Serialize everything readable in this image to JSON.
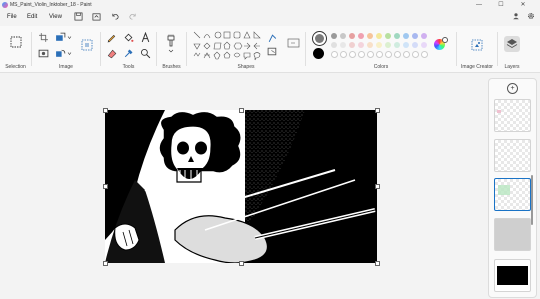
{
  "titlebar": {
    "title": "MS_Paint_Violin_Inktober_18 - Paint",
    "minimize": "—",
    "maximize": "☐",
    "close": "✕"
  },
  "menu": {
    "file": "File",
    "edit": "Edit",
    "view": "View"
  },
  "ribbon": {
    "selection": "Selection",
    "image": "Image",
    "tools": "Tools",
    "brushes": "Brushes",
    "shapes": "Shapes",
    "colors": "Colors",
    "image_creator": "Image Creator",
    "layers": "Layers"
  },
  "colors": {
    "primary": "#7a7a7a",
    "secondary": "#000000",
    "palette_row1": [
      "#9a9a9a",
      "#c8c8c8",
      "#e6a0a0",
      "#f0a0b0",
      "#f6c49a",
      "#f4e89a",
      "#b8e0a0",
      "#a0d8c0",
      "#a0c8f0",
      "#a8b8f0",
      "#d0b0f0"
    ],
    "palette_row2": [
      "#e0e0e0",
      "#e8e8e8",
      "#f0d0d0",
      "#f4d4dc",
      "#f8e0c8",
      "#f8f0c8",
      "#dcf0d0",
      "#d0ecdf",
      "#d0e4f8",
      "#d4dcf8",
      "#e8d8f8"
    ]
  },
  "layers": {
    "add": "+"
  }
}
